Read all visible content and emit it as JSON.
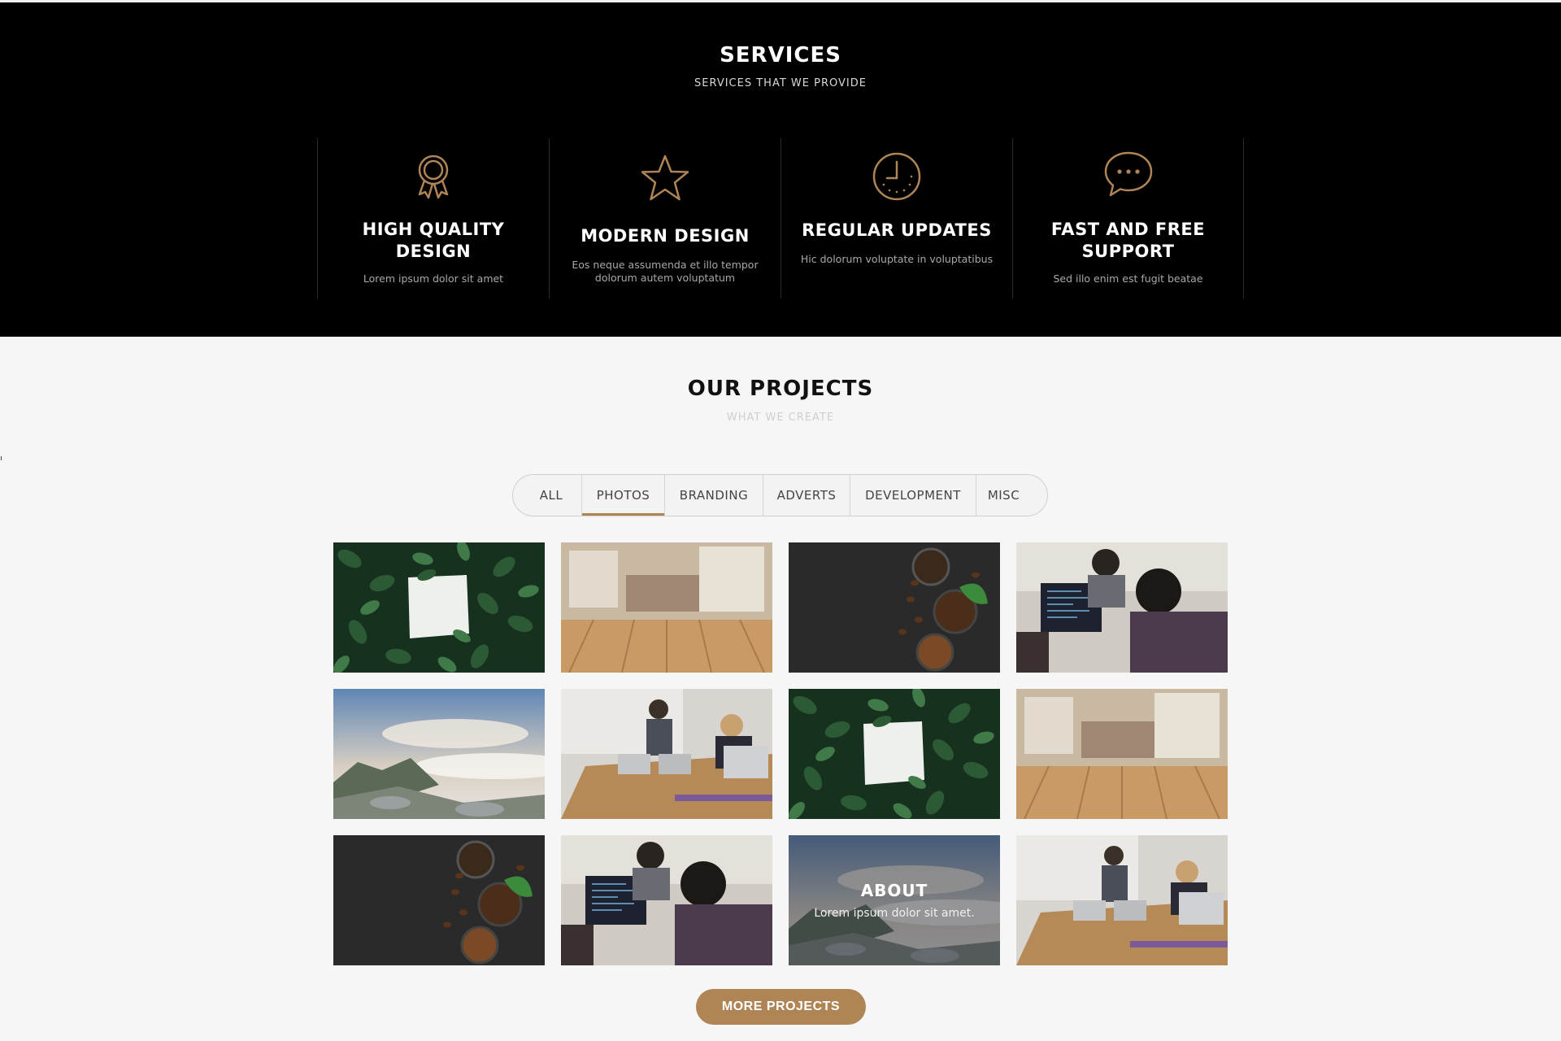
{
  "services": {
    "title": "SERVICES",
    "subtitle": "SERVICES THAT WE PROVIDE",
    "accent_color": "#b08556",
    "items": [
      {
        "icon": "award-icon",
        "title": "HIGH QUALITY DESIGN",
        "description": "Lorem ipsum dolor sit amet"
      },
      {
        "icon": "star-icon",
        "title": "MODERN DESIGN",
        "description": "Eos neque assumenda et illo tempor dolorum autem voluptatum"
      },
      {
        "icon": "clock-icon",
        "title": "REGULAR UPDATES",
        "description": "Hic dolorum voluptate in voluptatibus"
      },
      {
        "icon": "chat-bubble-icon",
        "title": "FAST AND FREE SUPPORT",
        "description": "Sed illo enim est fugit beatae"
      }
    ]
  },
  "projects": {
    "title": "OUR PROJECTS",
    "subtitle": "WHAT WE CREATE",
    "filters": [
      "ALL",
      "PHOTOS",
      "BRANDING",
      "ADVERTS",
      "DEVELOPMENT",
      "MISC"
    ],
    "active_filter": "PHOTOS",
    "tiles": [
      {
        "image": "leaves-paper"
      },
      {
        "image": "wooden-table-cafe"
      },
      {
        "image": "coffee-beans"
      },
      {
        "image": "office-developers"
      },
      {
        "image": "mountain-landscape"
      },
      {
        "image": "meeting-room"
      },
      {
        "image": "leaves-paper"
      },
      {
        "image": "wooden-table-cafe"
      },
      {
        "image": "coffee-beans"
      },
      {
        "image": "office-developers"
      },
      {
        "image": "mountain-landscape",
        "overlay_title": "ABOUT",
        "overlay_text": "Lorem ipsum dolor sit amet."
      },
      {
        "image": "meeting-room"
      }
    ],
    "more_button": "MORE PROJECTS"
  }
}
